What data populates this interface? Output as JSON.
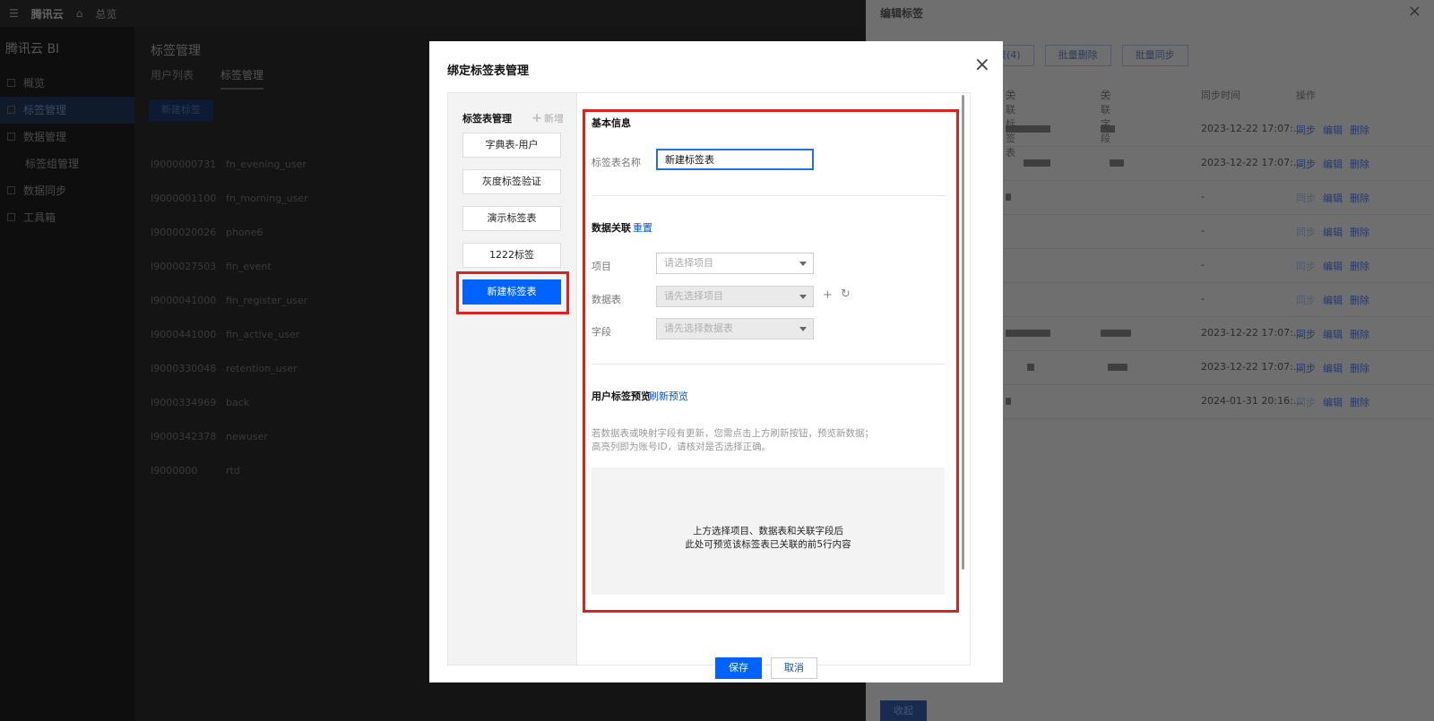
{
  "background": {
    "topbar": {
      "brand": "腾讯云",
      "nav": "总览"
    },
    "project_name": "腾讯云 BI",
    "left_nav": [
      "概览",
      "标签管理",
      "数据管理",
      "标签组管理",
      "数据同步",
      "工具箱"
    ],
    "page_title": "标签管理",
    "tabs": [
      "用户列表",
      "标签管理"
    ],
    "add_button": "新建标签",
    "rows": [
      {
        "id": "I9000000731",
        "name": "fn_evening_user"
      },
      {
        "id": "I9000001100",
        "name": "fn_morning_user"
      },
      {
        "id": "I9000020026",
        "name": "phone6"
      },
      {
        "id": "I9000027503",
        "name": "fin_event"
      },
      {
        "id": "I9000041000",
        "name": "fin_register_user"
      },
      {
        "id": "I9000441000",
        "name": "fin_active_user"
      },
      {
        "id": "I9000330048",
        "name": "retention_user"
      },
      {
        "id": "I9000334969",
        "name": "back"
      },
      {
        "id": "I9000342378",
        "name": "newuser"
      },
      {
        "id": "I9000000",
        "name": "rtd"
      }
    ]
  },
  "drawer": {
    "title": "编辑标签",
    "buttons": [
      "表(4)",
      "批量删除",
      "批量同步"
    ],
    "headers": {
      "table": "关联标签表",
      "field": "关联字段",
      "time": "同步时间",
      "ops": "操作"
    },
    "rows": [
      {
        "time": "2023-12-22 17:07:...",
        "sync": "同步",
        "edit": "编辑",
        "del": "删除",
        "sync_enabled": true
      },
      {
        "time": "2023-12-22 17:07:...",
        "sync": "同步",
        "edit": "编辑",
        "del": "删除",
        "sync_enabled": true
      },
      {
        "time": "-",
        "sync": "同步",
        "edit": "编辑",
        "del": "删除",
        "sync_enabled": false
      },
      {
        "time": "-",
        "sync": "同步",
        "edit": "编辑",
        "del": "删除",
        "sync_enabled": false
      },
      {
        "time": "-",
        "sync": "同步",
        "edit": "编辑",
        "del": "删除",
        "sync_enabled": false
      },
      {
        "time": "-",
        "sync": "同步",
        "edit": "编辑",
        "del": "删除",
        "sync_enabled": false
      },
      {
        "time": "2023-12-22 17:07:...",
        "sync": "同步",
        "edit": "编辑",
        "del": "删除",
        "sync_enabled": true
      },
      {
        "time": "2023-12-22 17:07:...",
        "sync": "同步",
        "edit": "编辑",
        "del": "删除",
        "sync_enabled": true
      },
      {
        "time": "2024-01-31 20:16:...",
        "sync": "同步",
        "edit": "编辑",
        "del": "删除",
        "sync_enabled": false
      }
    ],
    "collapse_button": "收起"
  },
  "modal": {
    "title": "绑定标签表管理",
    "sidebar": {
      "header": "标签表管理",
      "new_label": "新增",
      "items": [
        {
          "label": "字典表-用户",
          "active": false
        },
        {
          "label": "灰度标签验证",
          "active": false
        },
        {
          "label": "演示标签表",
          "active": false
        },
        {
          "label": "1222标签",
          "active": false
        },
        {
          "label": "新建标签表",
          "active": true
        }
      ]
    },
    "basic": {
      "title": "基本信息",
      "name_label": "标签表名称",
      "name_value": "新建标签表"
    },
    "relation": {
      "title": "数据关联",
      "reset": "重置",
      "project_label": "项目",
      "project_placeholder": "请选择项目",
      "table_label": "数据表",
      "table_placeholder": "请先选择项目",
      "field_label": "字段",
      "field_placeholder": "请先选择数据表"
    },
    "preview": {
      "title": "用户标签预览",
      "refresh": "刷新预览",
      "hint_line1": "若数据表或映射字段有更新，您需点击上方刷新按钮，预览新数据；",
      "hint_line2": "高亮列即为账号ID，请核对是否选择正确。",
      "empty_line1": "上方选择项目、数据表和关联字段后",
      "empty_line2": "此处可预览该标签表已关联的前5行内容"
    },
    "save_button": "保存",
    "cancel_button": "取消"
  },
  "colors": {
    "primary": "#0062ff",
    "link": "#0052d9",
    "highlight": "#d9231f"
  }
}
